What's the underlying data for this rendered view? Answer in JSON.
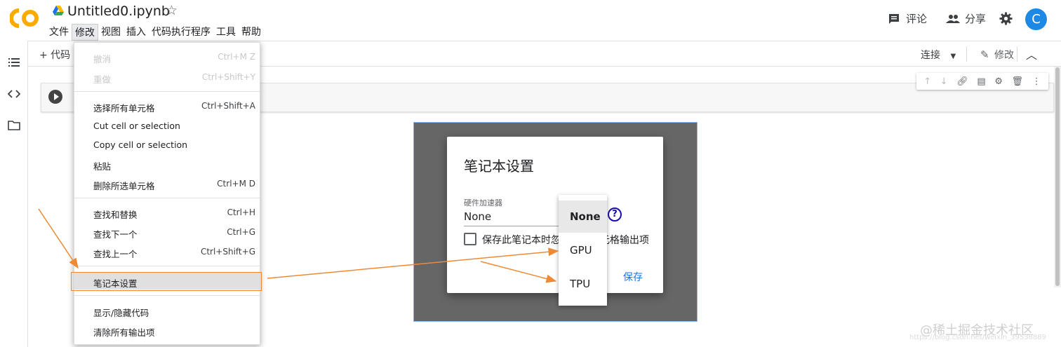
{
  "header": {
    "file_title": "Untitled0.ipynb",
    "comment_label": "评论",
    "share_label": "分享",
    "avatar_letter": "C"
  },
  "menubar": [
    "文件",
    "修改",
    "视图",
    "插入",
    "代码执行程序",
    "工具",
    "帮助"
  ],
  "toolbar": {
    "add_code": "+ 代码",
    "connect": "连接",
    "edit": "修改"
  },
  "edit_menu": {
    "items": [
      {
        "label": "撤消",
        "shortcut": "Ctrl+M Z",
        "disabled": true
      },
      {
        "label": "重做",
        "shortcut": "Ctrl+Shift+Y",
        "disabled": true
      },
      {
        "label": "选择所有单元格",
        "shortcut": "Ctrl+Shift+A"
      },
      {
        "label": "Cut cell or selection",
        "shortcut": ""
      },
      {
        "label": "Copy cell or selection",
        "shortcut": ""
      },
      {
        "label": "粘贴",
        "shortcut": ""
      },
      {
        "label": "删除所选单元格",
        "shortcut": "Ctrl+M D"
      },
      {
        "label": "查找和替换",
        "shortcut": "Ctrl+H"
      },
      {
        "label": "查找下一个",
        "shortcut": "Ctrl+G"
      },
      {
        "label": "查找上一个",
        "shortcut": "Ctrl+Shift+G"
      },
      {
        "label": "笔记本设置",
        "shortcut": ""
      },
      {
        "label": "显示/隐藏代码",
        "shortcut": ""
      },
      {
        "label": "清除所有输出项",
        "shortcut": ""
      }
    ]
  },
  "dialog": {
    "title": "笔记本设置",
    "hw_label": "硬件加速器",
    "hw_value": "None",
    "checkbox_label": "保存此笔记本时忽略代码单元格输出项",
    "save": "保存",
    "options": [
      "None",
      "GPU",
      "TPU"
    ],
    "selected": "None"
  },
  "watermark": {
    "text": "@稀土掘金技术社区",
    "url": "https://blog.csdn.net/weixin_39538889"
  },
  "colors": {
    "accent": "#1a73e8",
    "annotation": "#ee8a35",
    "logo": "#f9ab00"
  }
}
